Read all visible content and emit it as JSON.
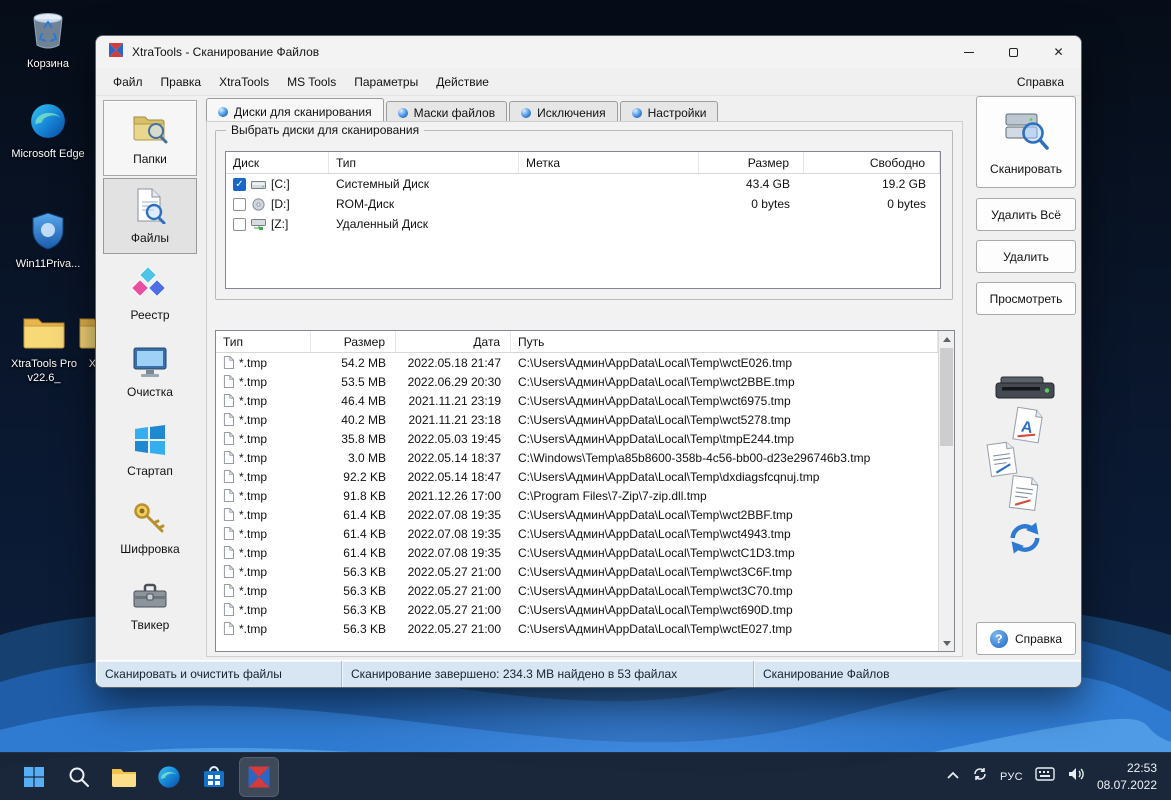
{
  "desktop": {
    "icons": [
      {
        "label": "Корзина",
        "icon": "recycle-bin-icon"
      },
      {
        "label": "Microsoft Edge",
        "icon": "edge-icon"
      },
      {
        "label": "Win11Priva...",
        "icon": "shield-icon"
      },
      {
        "label": "XtraTools Pro v22.6_",
        "icon": "folder-icon"
      },
      {
        "label": "Xtr...",
        "icon": "folder-icon"
      }
    ]
  },
  "window": {
    "title": "XtraTools - Сканирование Файлов",
    "menu": {
      "items": [
        "Файл",
        "Правка",
        "XtraTools",
        "MS Tools",
        "Параметры",
        "Действие"
      ],
      "right": "Справка"
    },
    "sidebar": {
      "items": [
        {
          "label": "Папки",
          "icon": "folder-search-icon"
        },
        {
          "label": "Файлы",
          "icon": "file-search-icon"
        },
        {
          "label": "Реестр",
          "icon": "registry-icon"
        },
        {
          "label": "Очистка",
          "icon": "cleanup-icon"
        },
        {
          "label": "Стартап",
          "icon": "startup-icon"
        },
        {
          "label": "Шифровка",
          "icon": "encrypt-icon"
        },
        {
          "label": "Твикер",
          "icon": "tweaker-icon"
        }
      ]
    },
    "tabs": [
      {
        "label": "Диски для сканирования",
        "active": true
      },
      {
        "label": "Маски файлов",
        "active": false
      },
      {
        "label": "Исключения",
        "active": false
      },
      {
        "label": "Настройки",
        "active": false
      }
    ],
    "drive_group": {
      "title": "Выбрать диски для сканирования",
      "columns": [
        "Диск",
        "Тип",
        "Метка",
        "Размер",
        "Свободно"
      ],
      "rows": [
        {
          "checked": true,
          "icon": "hdd-icon",
          "drive": "[C:]",
          "type": "Системный Диск",
          "label": "",
          "size": "43.4 GB",
          "free": "19.2 GB"
        },
        {
          "checked": false,
          "icon": "cdrom-icon",
          "drive": "[D:]",
          "type": "ROM-Диск",
          "label": "",
          "size": "0 bytes",
          "free": "0 bytes"
        },
        {
          "checked": false,
          "icon": "netdrive-icon",
          "drive": "[Z:]",
          "type": "Удаленный Диск",
          "label": "",
          "size": "",
          "free": ""
        }
      ]
    },
    "file_table": {
      "columns": [
        "Тип",
        "Размер",
        "Дата",
        "Путь"
      ],
      "rows": [
        {
          "type": "*.tmp",
          "size": "54.2 MB",
          "date": "2022.05.18 21:47",
          "path": "C:\\Users\\Админ\\AppData\\Local\\Temp\\wctE026.tmp"
        },
        {
          "type": "*.tmp",
          "size": "53.5 MB",
          "date": "2022.06.29 20:30",
          "path": "C:\\Users\\Админ\\AppData\\Local\\Temp\\wct2BBE.tmp"
        },
        {
          "type": "*.tmp",
          "size": "46.4 MB",
          "date": "2021.11.21 23:19",
          "path": "C:\\Users\\Админ\\AppData\\Local\\Temp\\wct6975.tmp"
        },
        {
          "type": "*.tmp",
          "size": "40.2 MB",
          "date": "2021.11.21 23:18",
          "path": "C:\\Users\\Админ\\AppData\\Local\\Temp\\wct5278.tmp"
        },
        {
          "type": "*.tmp",
          "size": "35.8 MB",
          "date": "2022.05.03 19:45",
          "path": "C:\\Users\\Админ\\AppData\\Local\\Temp\\tmpE244.tmp"
        },
        {
          "type": "*.tmp",
          "size": "3.0 MB",
          "date": "2022.05.14 18:37",
          "path": "C:\\Windows\\Temp\\a85b8600-358b-4c56-bb00-d23e296746b3.tmp"
        },
        {
          "type": "*.tmp",
          "size": "92.2 KB",
          "date": "2022.05.14 18:47",
          "path": "C:\\Users\\Админ\\AppData\\Local\\Temp\\dxdiagsfcqnuj.tmp"
        },
        {
          "type": "*.tmp",
          "size": "91.8 KB",
          "date": "2021.12.26 17:00",
          "path": "C:\\Program Files\\7-Zip\\7-zip.dll.tmp"
        },
        {
          "type": "*.tmp",
          "size": "61.4 KB",
          "date": "2022.07.08 19:35",
          "path": "C:\\Users\\Админ\\AppData\\Local\\Temp\\wct2BBF.tmp"
        },
        {
          "type": "*.tmp",
          "size": "61.4 KB",
          "date": "2022.07.08 19:35",
          "path": "C:\\Users\\Админ\\AppData\\Local\\Temp\\wct4943.tmp"
        },
        {
          "type": "*.tmp",
          "size": "61.4 KB",
          "date": "2022.07.08 19:35",
          "path": "C:\\Users\\Админ\\AppData\\Local\\Temp\\wctC1D3.tmp"
        },
        {
          "type": "*.tmp",
          "size": "56.3 KB",
          "date": "2022.05.27 21:00",
          "path": "C:\\Users\\Админ\\AppData\\Local\\Temp\\wct3C6F.tmp"
        },
        {
          "type": "*.tmp",
          "size": "56.3 KB",
          "date": "2022.05.27 21:00",
          "path": "C:\\Users\\Админ\\AppData\\Local\\Temp\\wct3C70.tmp"
        },
        {
          "type": "*.tmp",
          "size": "56.3 KB",
          "date": "2022.05.27 21:00",
          "path": "C:\\Users\\Админ\\AppData\\Local\\Temp\\wct690D.tmp"
        },
        {
          "type": "*.tmp",
          "size": "56.3 KB",
          "date": "2022.05.27 21:00",
          "path": "C:\\Users\\Админ\\AppData\\Local\\Temp\\wctE027.tmp"
        }
      ]
    },
    "actions": {
      "scan": "Сканировать",
      "delete_all": "Удалить Всё",
      "delete": "Удалить",
      "view": "Просмотреть",
      "help": "Справка"
    },
    "statusbar": {
      "left": "Сканировать и очистить файлы",
      "middle": "Сканирование завершено: 234.3 MB найдено в 53 файлах",
      "right": "Сканирование Файлов"
    }
  },
  "taskbar": {
    "language": "РУС",
    "time": "22:53",
    "date": "08.07.2022"
  },
  "colors": {
    "accent": "#1a66c9",
    "statusbar_bg": "#d8e6f4",
    "taskbar_bg": "#171e2c"
  }
}
